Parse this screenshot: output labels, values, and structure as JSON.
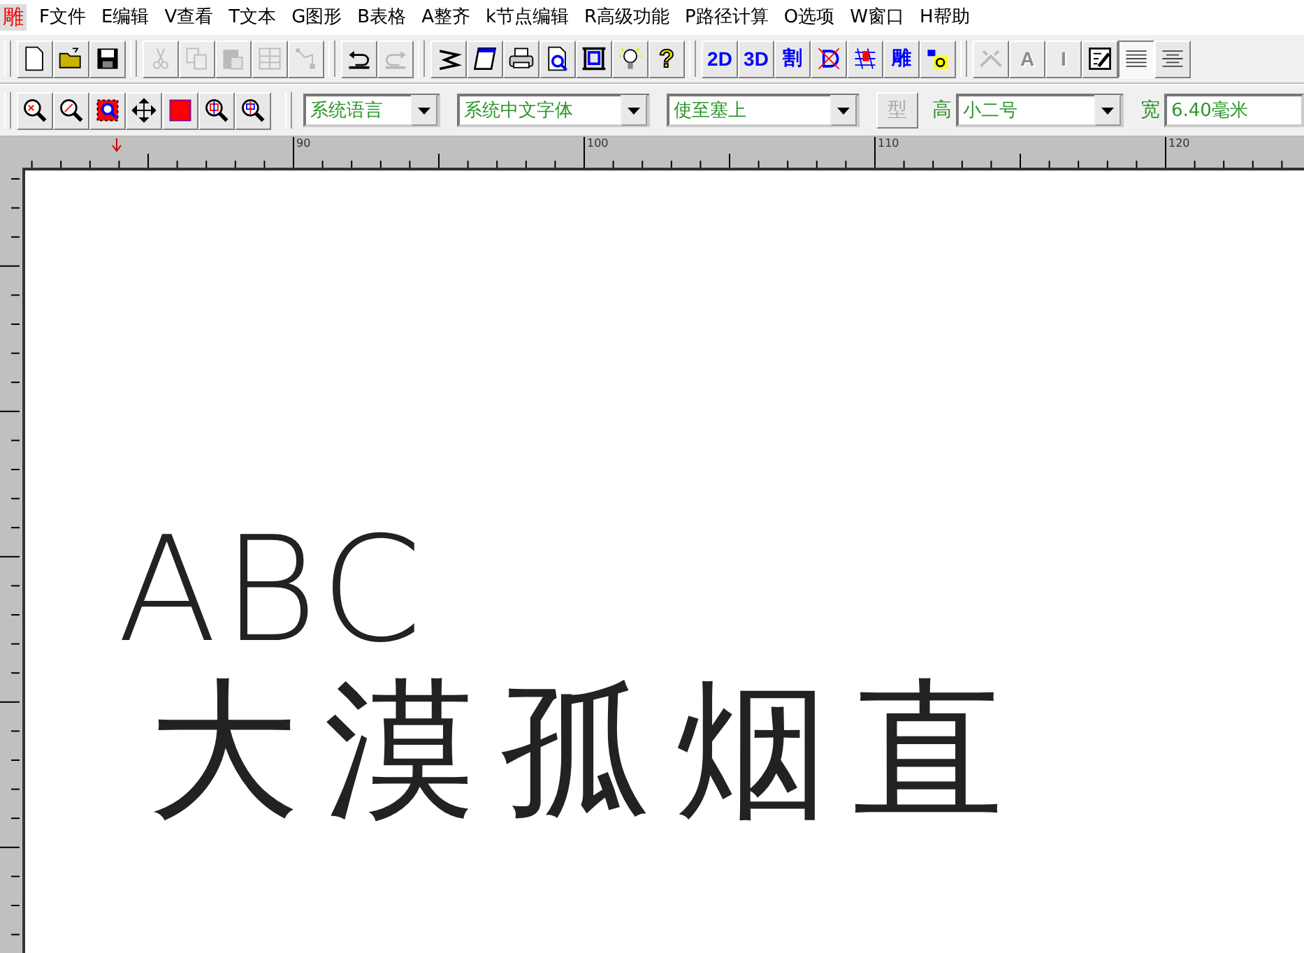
{
  "app_logo": "雕",
  "menu": [
    "F文件",
    "E编辑",
    "V查看",
    "T文本",
    "G图形",
    "B表格",
    "A整齐",
    "k节点编辑",
    "R高级功能",
    "P路径计算",
    "O选项",
    "W窗口",
    "H帮助"
  ],
  "toolbar_1": [
    [
      {
        "kind": "icon",
        "disabled": false
      },
      {
        "kind": "icon",
        "disabled": false
      },
      {
        "kind": "icon",
        "disabled": false
      }
    ],
    [
      {
        "kind": "icon",
        "disabled": true
      },
      {
        "kind": "icon",
        "disabled": true
      },
      {
        "kind": "icon",
        "disabled": true
      },
      {
        "kind": "icon",
        "disabled": true
      },
      {
        "kind": "icon",
        "disabled": true
      }
    ],
    [
      {
        "kind": "icon",
        "disabled": false
      },
      {
        "kind": "icon",
        "disabled": true
      }
    ],
    [
      {
        "kind": "icon",
        "disabled": false
      },
      {
        "kind": "icon",
        "disabled": false
      },
      {
        "kind": "icon",
        "disabled": false
      },
      {
        "kind": "icon",
        "disabled": false
      },
      {
        "kind": "icon",
        "disabled": false
      },
      {
        "kind": "icon",
        "disabled": false
      },
      {
        "kind": "text",
        "label": "?",
        "color": "#ffe600",
        "disabled": false
      }
    ],
    [
      {
        "kind": "text",
        "label": "2D",
        "color": "#0000ff",
        "disabled": false
      },
      {
        "kind": "text",
        "label": "3D",
        "color": "#0000ff",
        "disabled": false
      },
      {
        "kind": "text",
        "label": "割",
        "color": "#0000ff",
        "disabled": false
      },
      {
        "kind": "icon",
        "disabled": false
      },
      {
        "kind": "icon",
        "disabled": false
      },
      {
        "kind": "text",
        "label": "雕",
        "color": "#0000ff",
        "disabled": false
      },
      {
        "kind": "icon",
        "disabled": false
      }
    ],
    [
      {
        "kind": "icon",
        "disabled": true,
        "pressed": false
      },
      {
        "kind": "text",
        "label": "A",
        "disabled": true,
        "pressed": false
      },
      {
        "kind": "text",
        "label": "I",
        "disabled": true,
        "pressed": false
      },
      {
        "kind": "icon",
        "disabled": false,
        "pressed": false
      },
      {
        "kind": "icon",
        "disabled": false,
        "pressed": true
      },
      {
        "kind": "icon",
        "disabled": false,
        "pressed": false
      }
    ]
  ],
  "toolbar_2": {
    "tools": [
      {
        "kind": "icon"
      },
      {
        "kind": "icon"
      },
      {
        "kind": "icon"
      },
      {
        "kind": "icon"
      },
      {
        "kind": "icon"
      },
      {
        "kind": "icon"
      },
      {
        "kind": "icon"
      }
    ],
    "language": "系统语言",
    "font": "系统中文字体",
    "text_value": "使至塞上",
    "style_button": {
      "label": "型",
      "disabled": true
    },
    "height_label": "高",
    "height_value": "小二号",
    "width_label": "宽",
    "width_value": "6.40毫米"
  },
  "ruler_labels": [
    "90",
    "100",
    "110",
    "120"
  ],
  "canvas_texts": [
    {
      "text": "ABC"
    },
    {
      "text": "大漠孤烟直"
    }
  ]
}
